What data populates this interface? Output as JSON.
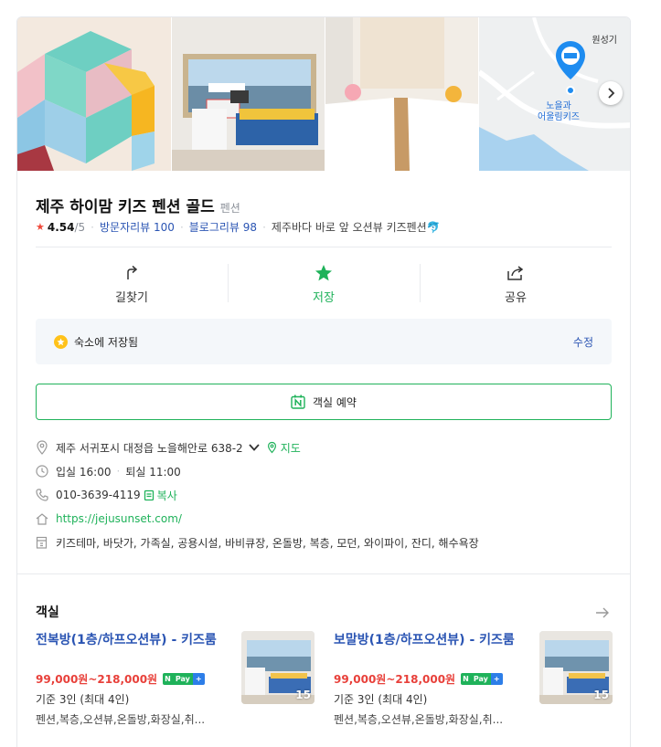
{
  "place": {
    "name": "제주 하이맘 키즈 펜션 골드",
    "category": "펜션",
    "rating": "4.54",
    "rating_max": "/5",
    "visitor_review_label": "방문자리뷰",
    "visitor_review_count": "100",
    "blog_review_label": "블로그리뷰",
    "blog_review_count": "98",
    "tagline": "제주바다 바로 앞 오션뷰 키즈펜션🐬"
  },
  "photos": {
    "map_area_label": "원성기",
    "map_place_label_line1": "노을과",
    "map_place_label_line2": "어울림키즈"
  },
  "actions": {
    "directions": "길찾기",
    "save": "저장",
    "share": "공유"
  },
  "saved": {
    "text": "숙소에 저장됨",
    "edit": "수정"
  },
  "reserve": {
    "label": "객실 예약"
  },
  "info": {
    "address": "제주 서귀포시 대정읍 노을해안로 638-2",
    "map_link": "지도",
    "checkin": "입실 16:00",
    "checkout": "퇴실 11:00",
    "phone": "010-3639-4119",
    "copy": "복사",
    "website": "https://jejusunset.com/",
    "amenities": "키즈테마, 바닷가, 가족실, 공용시설, 바비큐장, 온돌방, 복층, 모던, 와이파이, 잔디, 해수욕장"
  },
  "rooms": {
    "heading": "객실",
    "npay_n": "N",
    "npay_pay": "Pay",
    "npay_plus": "+",
    "items": [
      {
        "name": "전복방(1층/하프오션뷰) - 키즈룸",
        "price": "99,000원~218,000원",
        "capacity": "기준 3인 (최대 4인)",
        "features": "펜션,복층,오션뷰,온돌방,화장실,취...",
        "photo_count": "15"
      },
      {
        "name": "보말방(1층/하프오션뷰) - 키즈룸",
        "price": "99,000원~218,000원",
        "capacity": "기준 3인 (최대 4인)",
        "features": "펜션,복층,오션뷰,온돌방,화장실,취...",
        "photo_count": "15"
      }
    ]
  },
  "colors": {
    "accent_green": "#1fb25a",
    "link_blue": "#2b55b3",
    "price_red": "#e8403a",
    "star_red": "#f0493a"
  }
}
